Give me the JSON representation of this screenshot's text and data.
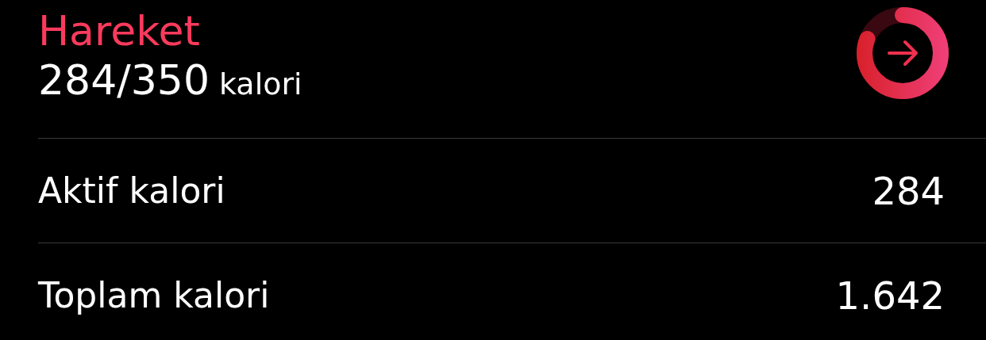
{
  "header": {
    "title": "Hareket",
    "value": "284/350",
    "unit": "kalori",
    "ring": {
      "level": 0.81
    }
  },
  "rows": [
    {
      "label": "Aktif kalori",
      "value": "284"
    },
    {
      "label": "Toplam kalori",
      "value": "1.642"
    }
  ]
}
